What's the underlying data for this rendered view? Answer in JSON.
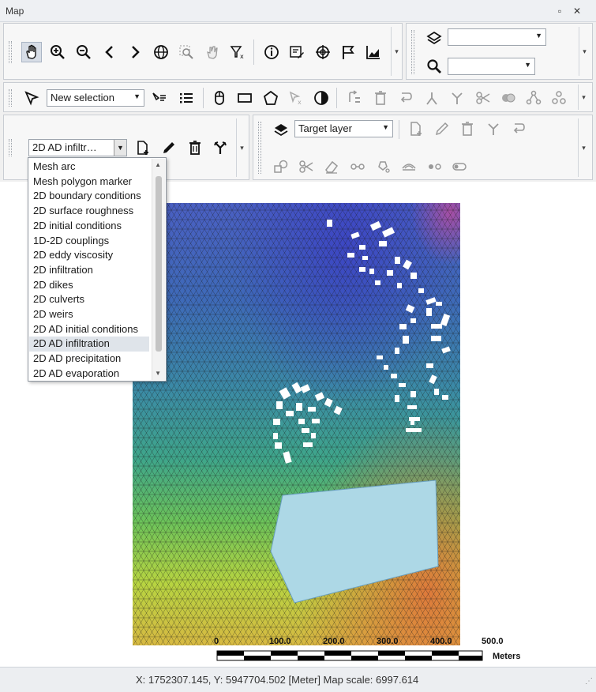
{
  "window": {
    "title": "Map"
  },
  "toolbar1": {
    "icons": [
      "pan-hand-icon",
      "zoom-in-icon",
      "zoom-out-icon",
      "previous-view-icon",
      "next-view-icon",
      "globe-icon",
      "zoom-selection-icon",
      "pan-selection-icon",
      "clear-selection-icon",
      "info-icon",
      "edit-attributes-icon",
      "crosshair-icon",
      "flag-icon",
      "chart-icon"
    ],
    "layer_combo": "",
    "search_combo": ""
  },
  "toolbar2": {
    "selection_mode": "New selection"
  },
  "toolbar3": {
    "layer_type_combo": "2D AD infiltr…",
    "target_layer_combo": "Target layer"
  },
  "dropdown": {
    "items": [
      "Mesh arc",
      "Mesh polygon marker",
      "2D boundary conditions",
      "2D surface roughness",
      "2D initial conditions",
      "1D-2D couplings",
      "2D eddy viscosity",
      "2D infiltration",
      "2D dikes",
      "2D culverts",
      "2D weirs",
      "2D AD initial conditions",
      "2D AD infiltration",
      "2D AD precipitation",
      "2D AD evaporation"
    ],
    "selected": "2D AD infiltration"
  },
  "map": {
    "scalebar_labels": [
      "0",
      "100.0",
      "200.0",
      "300.0",
      "400.0",
      "500.0"
    ],
    "scalebar_unit": "Meters"
  },
  "status": {
    "text": "X: 1752307.145, Y: 5947704.502 [Meter]    Map scale: 6997.614"
  }
}
